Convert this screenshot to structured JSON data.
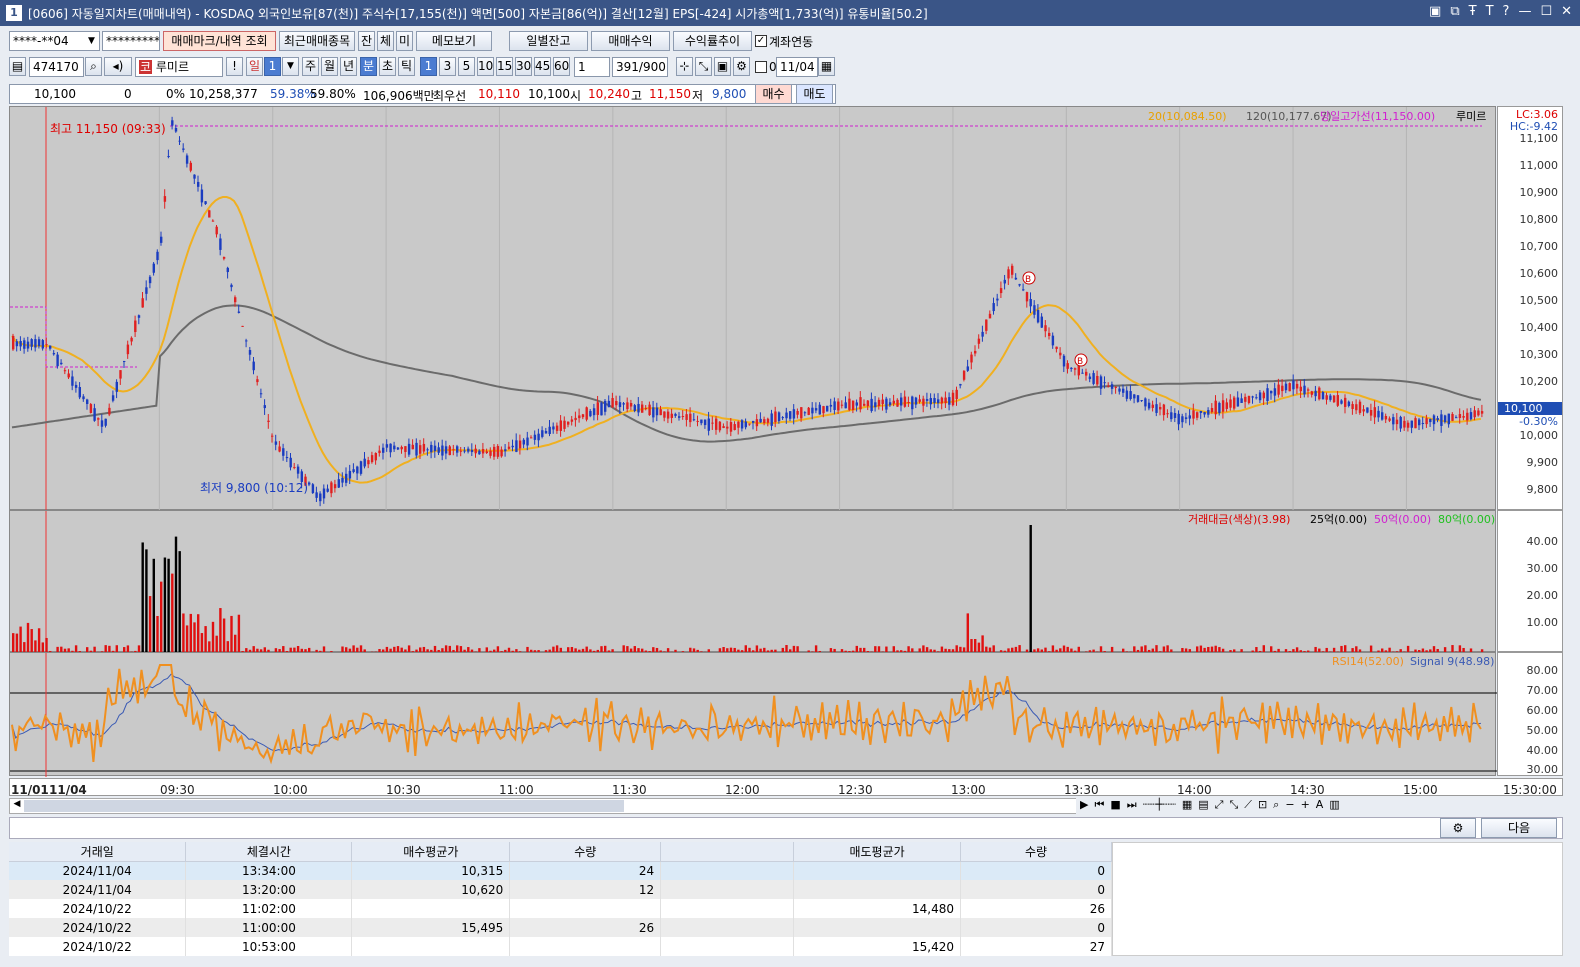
{
  "title": "[0606] 자동일지차트(매매내역) - KOSDAQ 외국인보유[87(천)] 주식수[17,155(천)] 액면[500] 자본금[86(억)] 결산[12월] EPS[-424] 시가총액[1,733(억)] 유통비율[50.2]",
  "window_num": "1",
  "window_controls": [
    "▣",
    "⧉",
    "Ŧ",
    "T",
    "?",
    "—",
    "☐",
    "✕"
  ],
  "toolbar1": {
    "account": "****-**04",
    "password": "*********",
    "btn_mark": "매매마크/내역 조회",
    "btn_recent": "최근매매종목",
    "btn_jan": "잔",
    "btn_che": "체",
    "btn_mi": "미",
    "btn_memo": "메모보기",
    "btn_daily": "일별잔고",
    "btn_sell_profit": "매매수익",
    "btn_rate": "수익률추이",
    "chk_link": "계좌연동"
  },
  "toolbar2": {
    "code": "474170",
    "name": "루미르",
    "ex": "!",
    "period_day": "일",
    "period_sel": "1",
    "week": "주",
    "month": "월",
    "year": "년",
    "min": "분",
    "sec": "초",
    "tick": "틱",
    "intervals": [
      "1",
      "3",
      "5",
      "10",
      "15",
      "30",
      "45",
      "60"
    ],
    "interval_sel": "1",
    "count": "391",
    "count_max": "/900",
    "date": "11/04",
    "chk0": "0"
  },
  "info": {
    "price": "10,100",
    "change": "0",
    "rate": "0%",
    "volume": "10,258,377",
    "r1": "59.38%",
    "r2": "59.80%",
    "amount": "106,906백만",
    "best": "최우선",
    "best_sell": "10,110",
    "best_buy": "10,100",
    "open_l": "시",
    "open": "10,240",
    "high_l": "고",
    "high": "11,150",
    "low_l": "저",
    "low": "9,800",
    "buy": "매수",
    "sell": "매도"
  },
  "chart": {
    "legend_ma": "20(10,084.50)",
    "legend_ma120": "120(10,177.67)",
    "legend_high": "당일고가선(11,150.00)",
    "legend_name": "루미르",
    "lc": "LC:3.06",
    "hc": "HC:-9.42",
    "high_label": "최고 11,150 (09:33)",
    "low_label": "최저 9,800 (10:12)",
    "price_ticks": [
      "11,100",
      "11,000",
      "10,900",
      "10,800",
      "10,700",
      "10,600",
      "10,500",
      "10,400",
      "10,300",
      "10,200",
      "10,000",
      "9,900",
      "9,800"
    ],
    "current_price": "10,100",
    "current_rate": "-0.30%",
    "vol_legend": "거래대금(색상)(3.98)",
    "vol_l2": "25억(0.00)",
    "vol_l3": "50억(0.00)",
    "vol_l4": "80억(0.00)",
    "vol_ticks": [
      "40.00",
      "30.00",
      "20.00",
      "10.00"
    ],
    "rsi_legend": "RSI14(52.00)",
    "rsi_signal": "Signal 9(48.98)",
    "rsi_ticks": [
      "80.00",
      "70.00",
      "60.00",
      "50.00",
      "40.00",
      "30.00"
    ],
    "time_labels": [
      "11/01",
      "11/04",
      "09:30",
      "10:00",
      "10:30",
      "11:00",
      "11:30",
      "12:00",
      "12:30",
      "13:00",
      "13:30",
      "14:00",
      "14:30",
      "15:00",
      "15:30:00"
    ],
    "markers": [
      "B",
      "B"
    ]
  },
  "bottom": {
    "btn_next": "다음"
  },
  "table": {
    "headers": [
      "거래일",
      "체결시간",
      "매수평균가",
      "수량",
      "",
      "매도평균가",
      "수량"
    ],
    "rows": [
      [
        "2024/11/04",
        "13:34:00",
        "10,315",
        "24",
        "",
        "",
        "0"
      ],
      [
        "2024/11/04",
        "13:20:00",
        "10,620",
        "12",
        "",
        "",
        "0"
      ],
      [
        "2024/10/22",
        "11:02:00",
        "",
        "",
        "",
        "14,480",
        "26"
      ],
      [
        "2024/10/22",
        "11:00:00",
        "15,495",
        "26",
        "",
        "",
        "0"
      ],
      [
        "2024/10/22",
        "10:53:00",
        "",
        "",
        "",
        "15,420",
        "27"
      ]
    ]
  },
  "chart_data": {
    "type": "line",
    "title": "",
    "xlabel": "",
    "ylabel": "",
    "x": [
      "09:00",
      "09:15",
      "09:30",
      "09:33",
      "09:45",
      "10:00",
      "10:12",
      "10:30",
      "11:00",
      "11:30",
      "12:00",
      "12:30",
      "13:00",
      "13:15",
      "13:30",
      "14:00",
      "14:30",
      "15:00",
      "15:20"
    ],
    "series": [
      {
        "name": "",
        "values": [
          10350,
          10050,
          10700,
          11150,
          10750,
          10000,
          9800,
          9980,
          9960,
          10140,
          10050,
          10130,
          10150,
          10620,
          10270,
          10080,
          10200,
          10060,
          10100
        ]
      }
    ],
    "ylim": [
      9750,
      11200
    ]
  }
}
